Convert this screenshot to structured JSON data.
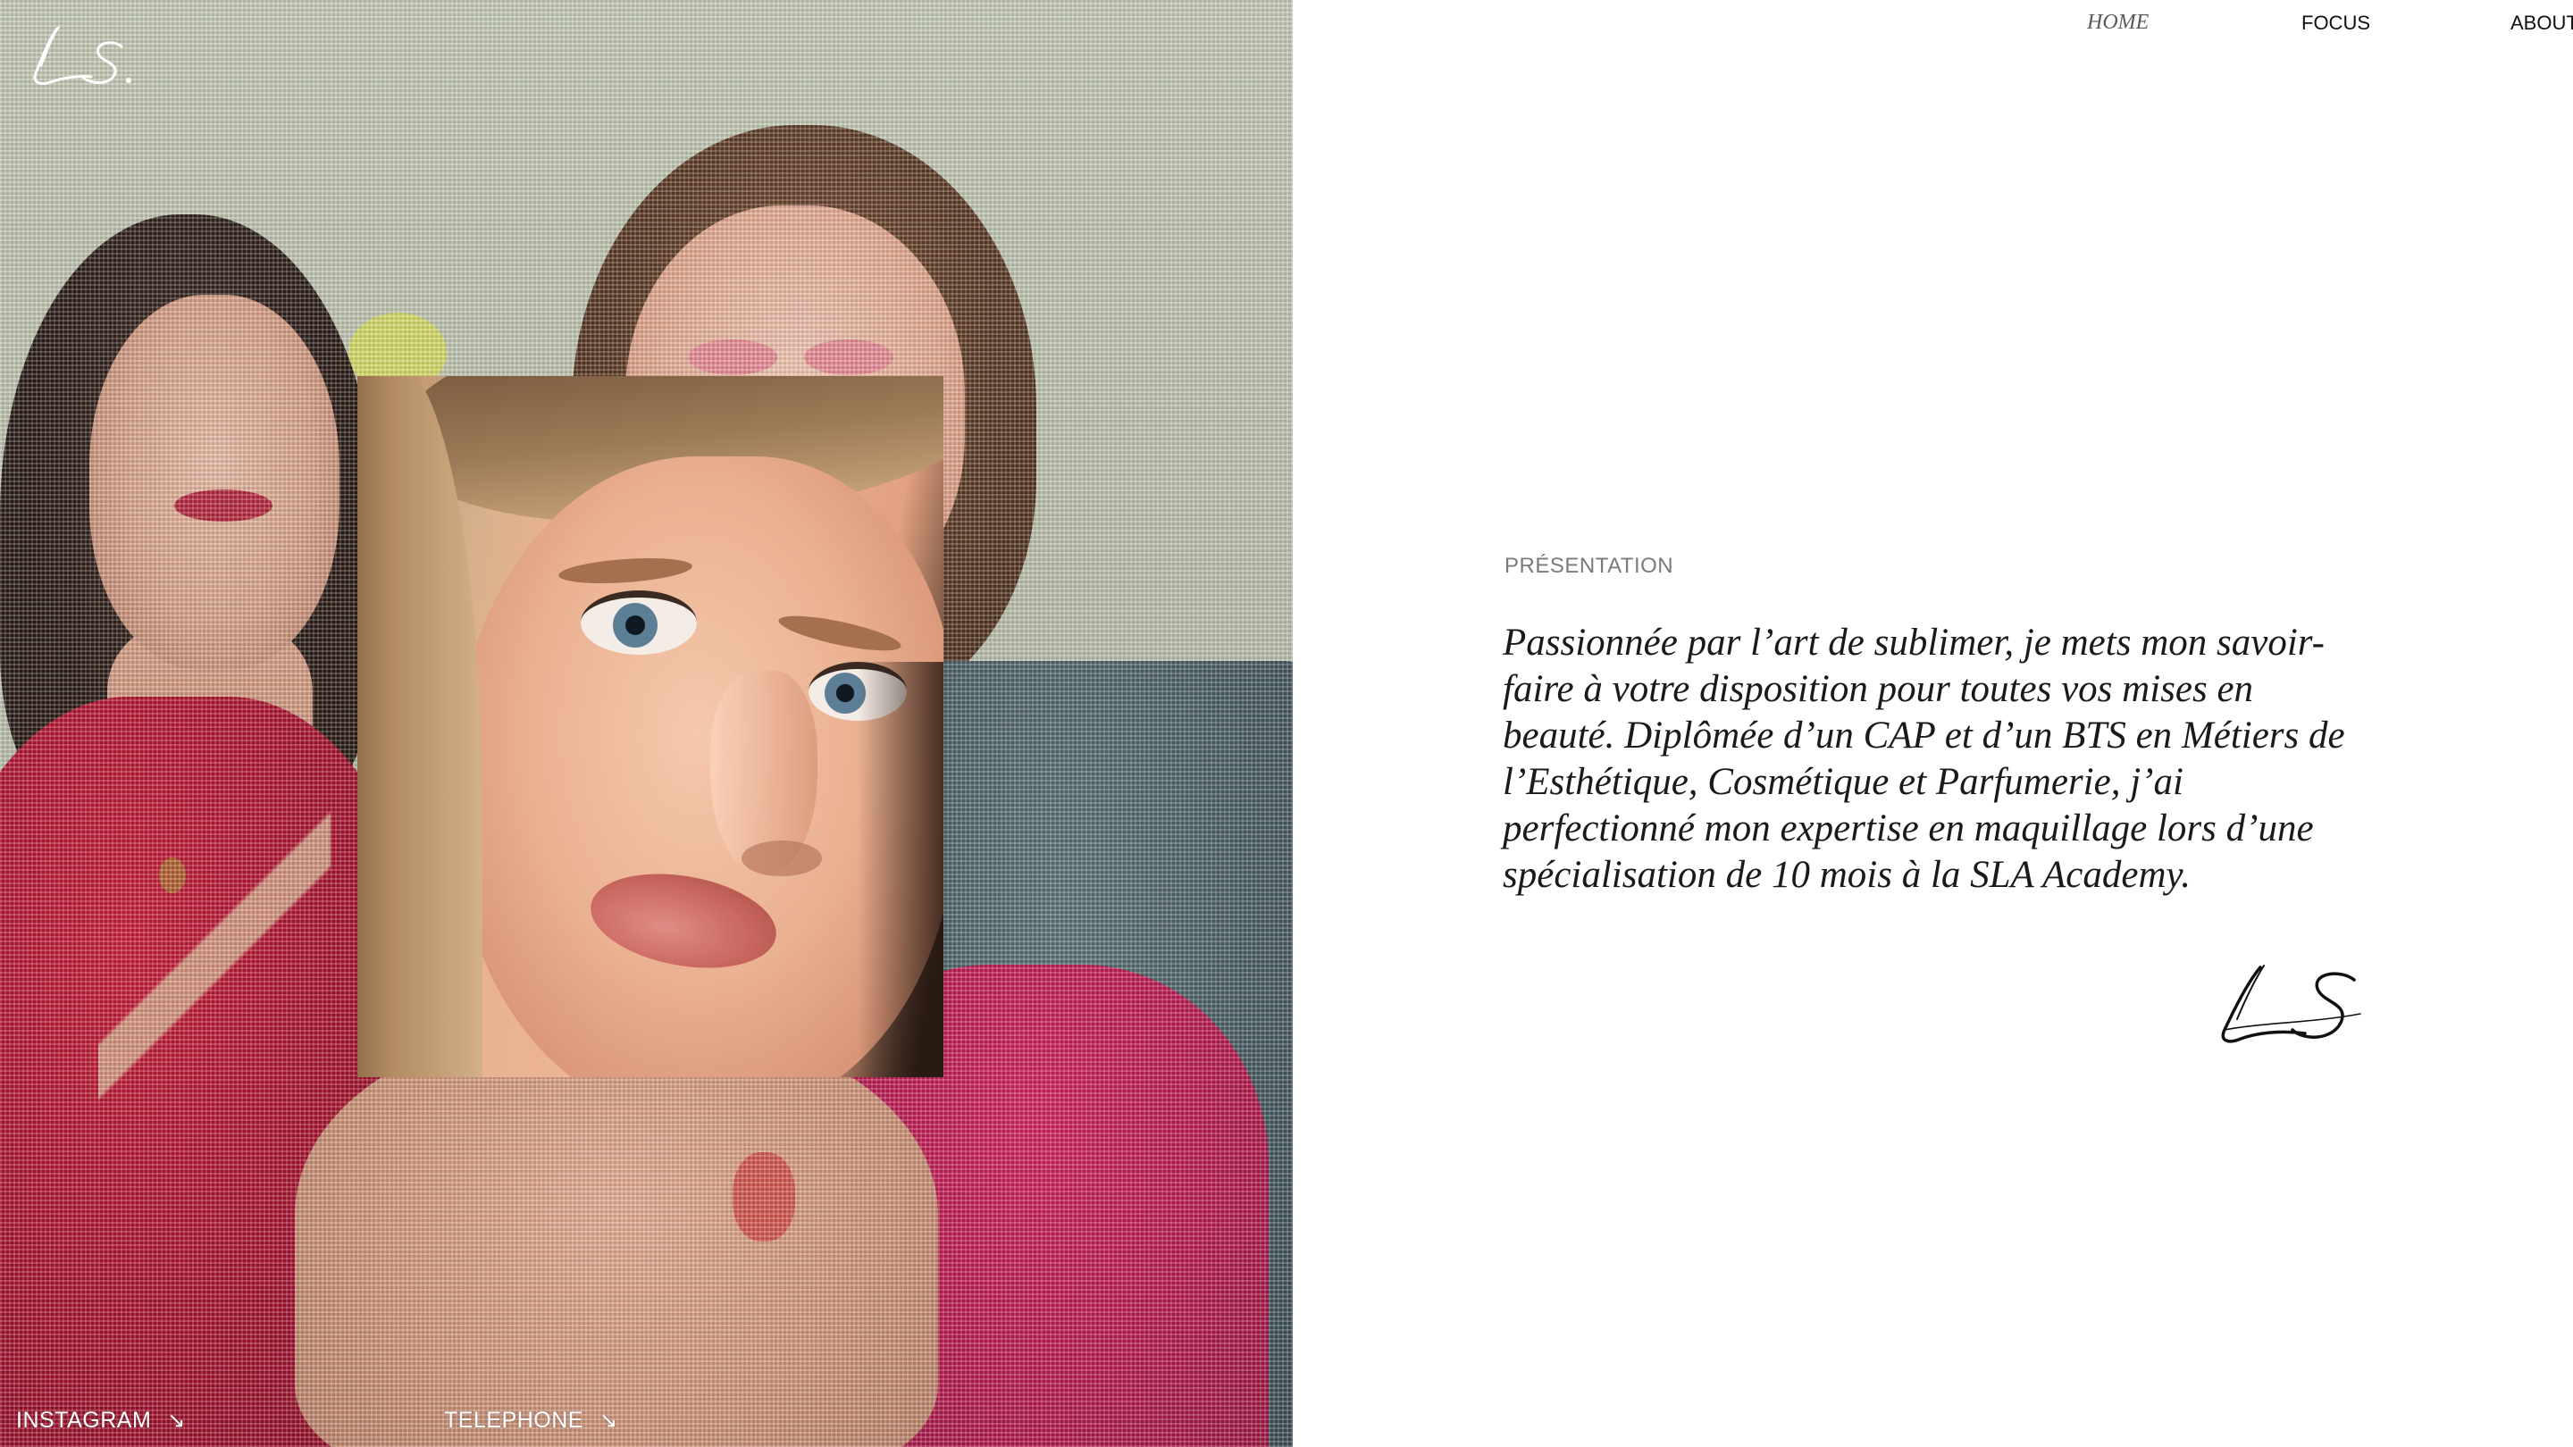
{
  "nav": {
    "home": "HOME",
    "focus": "FOCUS",
    "about": "ABOUT"
  },
  "brand": {
    "logo_text": "L.S."
  },
  "presentation": {
    "label": "PRÉSENTATION",
    "text": "Passionnée par l’art de sublimer, je mets mon savoir-faire à votre disposition pour toutes vos mises en beauté. Diplômée d’un CAP et d’un BTS en Métiers de l’Esthétique, Cosmétique et Parfumerie, j’ai perfectionné mon expertise en maquillage lors d’une spécialisation de 10 mois à la SLA Academy."
  },
  "links": {
    "instagram": "INSTAGRAM",
    "telephone": "TELEPHONE",
    "arrow_icon": "arrow-down-right-icon"
  },
  "colors": {
    "text": "#1a1a1a",
    "muted": "#7a7a7a",
    "background": "#ffffff"
  }
}
